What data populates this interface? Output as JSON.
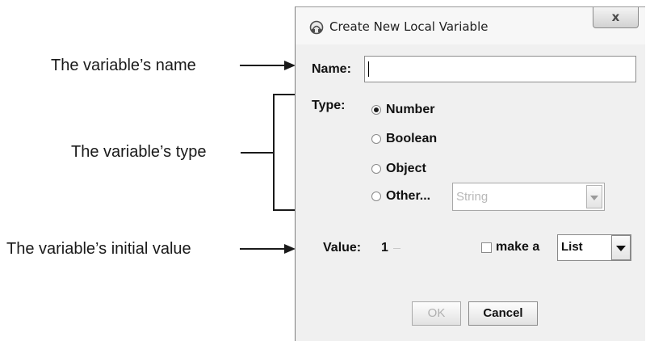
{
  "annotations": {
    "name": "The variable’s name",
    "type": "The variable’s type",
    "value": "The variable’s initial value"
  },
  "dialog": {
    "title": "Create New Local Variable",
    "close_label": "x",
    "name_label": "Name:",
    "name_value": "",
    "type_label": "Type:",
    "type_options": [
      "Number",
      "Boolean",
      "Object",
      "Other..."
    ],
    "selected_type": "Number",
    "other_type_value": "String",
    "value_label": "Value:",
    "value_value": "1",
    "make_a_label": "make a",
    "make_a_checked": false,
    "collection_value": "List",
    "ok_label": "OK",
    "cancel_label": "Cancel"
  },
  "colors": {
    "dialog_bg": "#f0f0f0",
    "disabled_text": "#b0b0b0",
    "annotation_line": "#1a1a1a"
  },
  "icons": [
    "app-icon",
    "close-icon",
    "dropdown-arrow-icon"
  ]
}
